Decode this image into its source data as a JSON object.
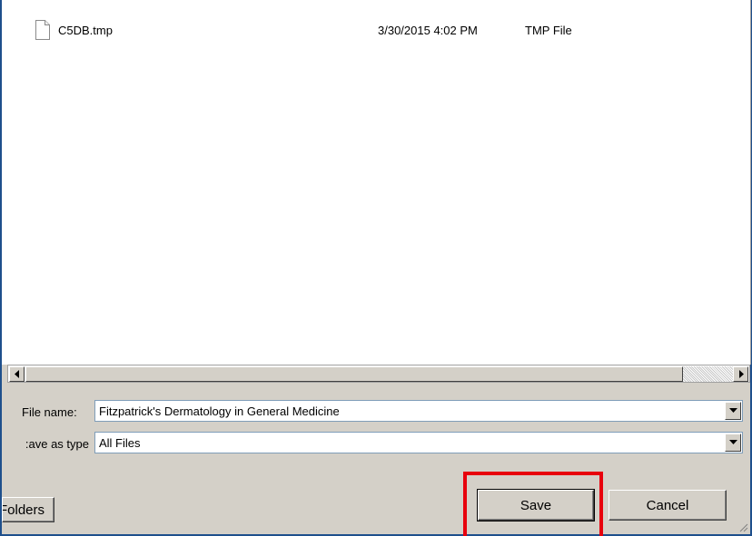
{
  "file_list": {
    "rows": [
      {
        "icon": "document-icon",
        "name": "C5DB.tmp",
        "date": "3/30/2015 4:02 PM",
        "type": "TMP File"
      }
    ]
  },
  "form": {
    "file_name_label": "File name:",
    "file_name_value": "Fitzpatrick's Dermatology in General Medicine",
    "save_as_type_label": "ave as type:",
    "save_as_type_value": "All Files"
  },
  "buttons": {
    "folders_label": "Folders",
    "save_label": "Save",
    "cancel_label": "Cancel"
  },
  "colors": {
    "highlight": "#e8000d",
    "window_frame": "#1e4f8c",
    "dialog_background": "#d4d0c8"
  }
}
